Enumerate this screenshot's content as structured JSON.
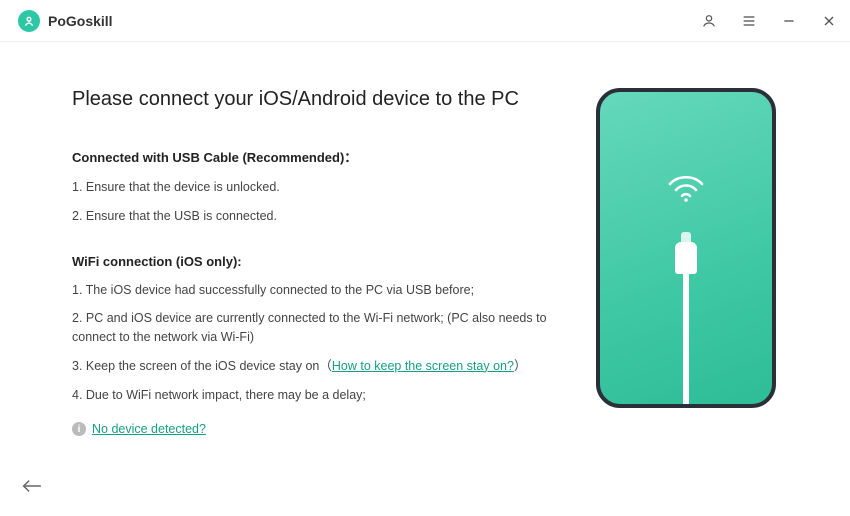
{
  "app": {
    "name": "PoGoskill"
  },
  "titlebar": {
    "account_icon": "account-icon",
    "menu_icon": "menu-icon",
    "minimize_icon": "minimize-icon",
    "close_icon": "close-icon"
  },
  "title": "Please connect your iOS/Android device to the PC",
  "usb": {
    "heading": "Connected with USB Cable (Recommended)：",
    "step1": "1. Ensure that the device is unlocked.",
    "step2": "2. Ensure that the USB is connected."
  },
  "wifi": {
    "heading": "WiFi connection (iOS only):",
    "step1": "1. The iOS device had successfully connected to the PC via USB before;",
    "step2": "2. PC and iOS device are currently connected to the Wi-Fi network; (PC also needs to connect to the network via Wi-Fi)",
    "step3_prefix": "3. Keep the screen of the iOS device stay on（",
    "step3_link": "How to keep the screen stay on?",
    "step3_suffix": "）",
    "step4": "4. Due to WiFi network impact, there may be a delay;"
  },
  "no_device_link": "No device detected?",
  "illustration": {
    "wifi_icon": "wifi-icon",
    "cable_icon": "lightning-cable-icon"
  },
  "back_label": "Back",
  "colors": {
    "accent": "#16a085",
    "phone_border": "#2a2f3a",
    "phone_bg": "#3fc8a4"
  }
}
